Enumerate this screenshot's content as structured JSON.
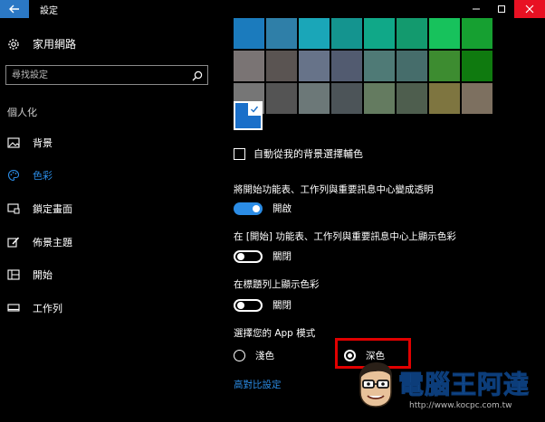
{
  "window": {
    "title": "設定"
  },
  "sidebar": {
    "home_label": "家用網路",
    "search_placeholder": "尋找設定",
    "section_label": "個人化",
    "items": [
      {
        "label": "背景",
        "icon": "picture-icon",
        "active": false
      },
      {
        "label": "色彩",
        "icon": "palette-icon",
        "active": true
      },
      {
        "label": "鎖定畫面",
        "icon": "lock-screen-icon",
        "active": false
      },
      {
        "label": "佈景主題",
        "icon": "theme-brush-icon",
        "active": false
      },
      {
        "label": "開始",
        "icon": "start-tiles-icon",
        "active": false
      },
      {
        "label": "工作列",
        "icon": "taskbar-icon",
        "active": false
      }
    ]
  },
  "colors": {
    "accent": "#2b8ce5",
    "selected_swatch": "#1a6fc9",
    "close_button": "#e81123",
    "highlight_box": "#e00000",
    "swatch_grid": [
      "#1b7bbd",
      "#2f7fa8",
      "#1aa6b8",
      "#14948f",
      "#10a888",
      "#139a6e",
      "#17c25c",
      "#16a031",
      "#7a7474",
      "#5a5452",
      "#677389",
      "#525b70",
      "#4f7a76",
      "#466d6b",
      "#3d8c30",
      "#0f7a0f",
      "#767676",
      "#545454",
      "#6c7878",
      "#4c5458",
      "#647b60",
      "#4e5e4e",
      "#7e7540",
      "#7d7060"
    ]
  },
  "options": {
    "auto_pick_label": "自動從我的背景選擇輔色",
    "transparency_label": "將開始功能表、工作列與重要訊息中心變成透明",
    "transparency_state": "開啟",
    "show_start_color_label": "在 [開始] 功能表、工作列與重要訊息中心上顯示色彩",
    "show_start_color_state": "關閉",
    "show_title_color_label": "在標題列上顯示色彩",
    "show_title_color_state": "關閉",
    "app_mode_label": "選擇您的 App 模式",
    "light_label": "淺色",
    "dark_label": "深色",
    "high_contrast_link": "高對比設定"
  },
  "watermark": {
    "title": "電腦王阿達",
    "url": "http://www.kocpc.com.tw"
  }
}
